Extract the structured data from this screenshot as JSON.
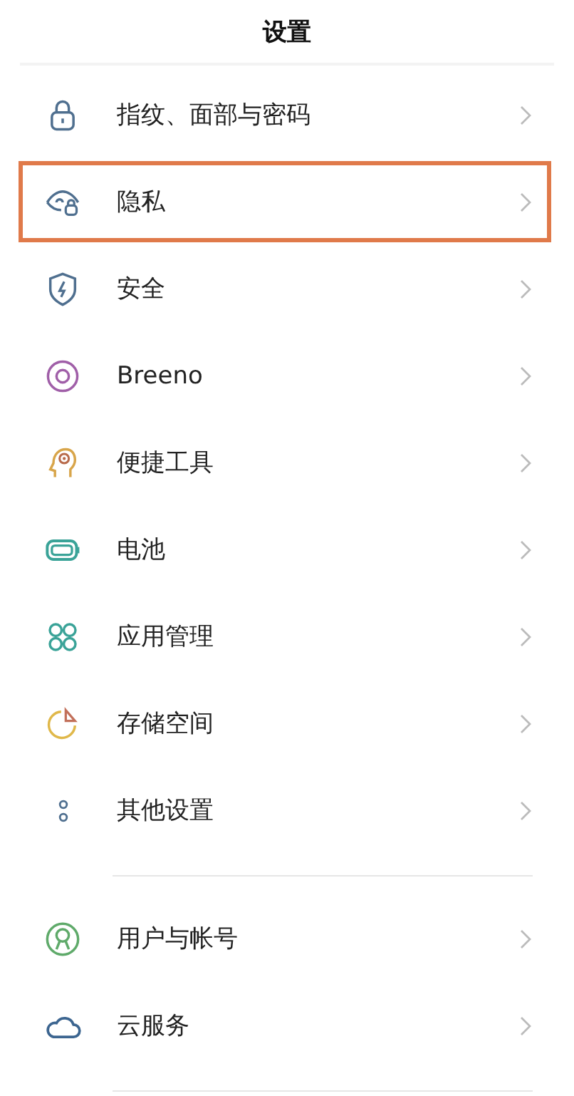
{
  "title": "设置",
  "sections": [
    {
      "items": [
        {
          "label": "指纹、面部与密码",
          "highlighted": false
        },
        {
          "label": "隐私",
          "highlighted": true
        },
        {
          "label": "安全",
          "highlighted": false
        },
        {
          "label": "Breeno",
          "highlighted": false
        },
        {
          "label": "便捷工具",
          "highlighted": false
        },
        {
          "label": "电池",
          "highlighted": false
        },
        {
          "label": "应用管理",
          "highlighted": false
        },
        {
          "label": "存储空间",
          "highlighted": false
        },
        {
          "label": "其他设置",
          "highlighted": false
        }
      ]
    },
    {
      "items": [
        {
          "label": "用户与帐号",
          "highlighted": false
        },
        {
          "label": "云服务",
          "highlighted": false
        }
      ]
    }
  ]
}
